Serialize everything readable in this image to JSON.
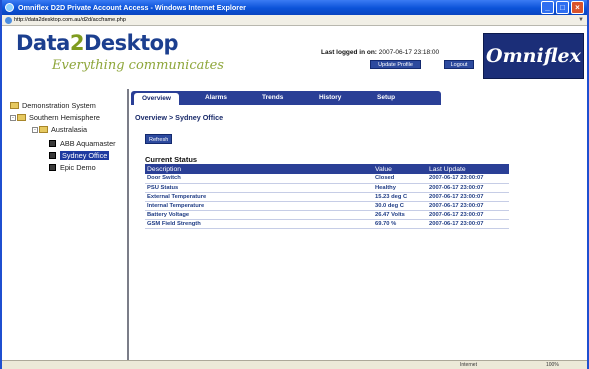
{
  "window": {
    "title": "Omniflex D2D Private Account Access - Windows Internet Explorer",
    "address": "http://data2desktop.com.au/d2d/accframe.php"
  },
  "header": {
    "brand_part1": "Data",
    "brand_part2": "2",
    "brand_part3": "Desktop",
    "tagline": "Everything communicates",
    "last_logged_label": "Last logged in on:",
    "last_logged_value": "2007-06-17 23:18:00",
    "update_profile": "Update Profile",
    "logout": "Logout",
    "omniflex_logo": "Omniflex"
  },
  "tree": {
    "root": "Demonstration System",
    "region": "Southern Hemisphere",
    "country": "Australasia",
    "items": [
      "ABB Aquamaster",
      "Sydney Office",
      "Epic Demo"
    ]
  },
  "tabs": [
    "Overview",
    "Alarms",
    "Trends",
    "History",
    "Setup"
  ],
  "main": {
    "breadcrumb": "Overview > Sydney Office",
    "refresh": "Refresh",
    "section_title": "Current Status",
    "columns": [
      "Description",
      "Value",
      "Last Update"
    ],
    "rows": [
      {
        "description": "Door Switch",
        "value": "Closed",
        "last_update": "2007-06-17 23:00:07"
      },
      {
        "description": "PSU Status",
        "value": "Healthy",
        "last_update": "2007-06-17 23:00:07"
      },
      {
        "description": "External Temperature",
        "value": "15.23 deg C",
        "last_update": "2007-06-17 23:00:07"
      },
      {
        "description": "Internal Temperature",
        "value": "30.0 deg C",
        "last_update": "2007-06-17 23:00:07"
      },
      {
        "description": "Battery Voltage",
        "value": "26.47 Volts",
        "last_update": "2007-06-17 23:00:07"
      },
      {
        "description": "GSM Field Strength",
        "value": "69.70 %",
        "last_update": "2007-06-17 23:00:07"
      }
    ]
  },
  "statusbar": {
    "zone": "Internet",
    "zoom": "100%"
  }
}
